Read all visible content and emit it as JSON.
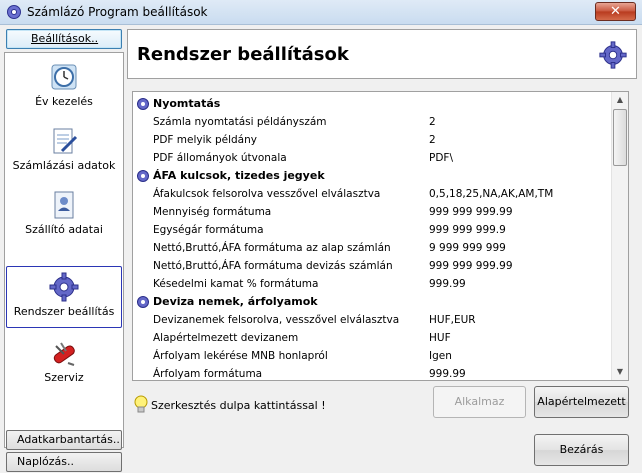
{
  "window": {
    "title": "Számlázó Program beállítások",
    "close_glyph": "✕"
  },
  "sidebar": {
    "top_button": "Beállítások..",
    "items": [
      {
        "label": "Év kezelés",
        "icon": "clock-icon"
      },
      {
        "label": "Számlázási adatok",
        "icon": "document-edit-icon"
      },
      {
        "label": "Szállító adatai",
        "icon": "contact-card-icon"
      },
      {
        "label": "Rendszer beállítás",
        "icon": "gear-icon",
        "active": true
      },
      {
        "label": "Szerviz",
        "icon": "swiss-knife-icon"
      }
    ],
    "bottom_buttons": [
      "Adatkarbantartás..",
      "Naplózás.."
    ]
  },
  "header": {
    "title": "Rendszer beállítások"
  },
  "settings": {
    "cat1": {
      "label": "Nyomtatás"
    },
    "cat1_rows": [
      {
        "label": "Számla nyomtatási példányszám",
        "value": "2"
      },
      {
        "label": "PDF melyik példány",
        "value": "2"
      },
      {
        "label": "PDF állományok útvonala",
        "value": "PDF\\"
      }
    ],
    "cat2": {
      "label": "ÁFA kulcsok, tizedes jegyek"
    },
    "cat2_rows": [
      {
        "label": "Áfakulcsok felsorolva vesszővel elválasztva",
        "value": "0,5,18,25,NA,AK,AM,TM"
      },
      {
        "label": "Mennyiség formátuma",
        "value": "999 999 999.99"
      },
      {
        "label": "Egységár formátuma",
        "value": "999 999 999.9"
      },
      {
        "label": "Nettó,Bruttó,ÁFA formátuma az alap számlán",
        "value": "9 999 999 999"
      },
      {
        "label": "Nettó,Bruttó,ÁFA formátuma devizás számlán",
        "value": "999 999 999.99"
      },
      {
        "label": "Késedelmi kamat % formátuma",
        "value": "999.99"
      }
    ],
    "cat3": {
      "label": "Deviza nemek, árfolyamok"
    },
    "cat3_rows": [
      {
        "label": "Devizanemek felsorolva, vesszővel elválasztva",
        "value": "HUF,EUR"
      },
      {
        "label": "Alapértelmezett devizanem",
        "value": "HUF"
      },
      {
        "label": "Árfolyam lekérése MNB honlapról",
        "value": "Igen"
      },
      {
        "label": "Árfolyam formátuma",
        "value": "999.99"
      }
    ]
  },
  "hint": {
    "text": "Szerkesztés dulpa kattintással !"
  },
  "buttons": {
    "apply": "Alkalmaz",
    "default": "Alapértelmezett",
    "close": "Bezárás"
  },
  "scrollbar": {
    "up": "▲",
    "down": "▼",
    "position": 0.0
  }
}
